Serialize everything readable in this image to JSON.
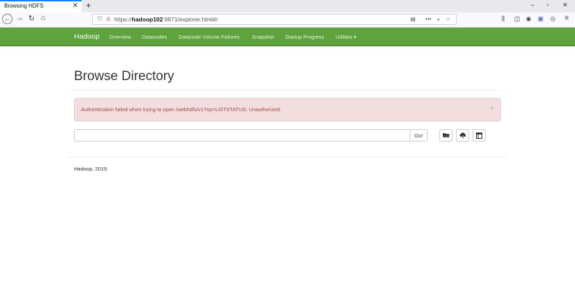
{
  "browser": {
    "tab_title": "Browsing HDFS",
    "tab_close": "✕",
    "new_tab": "+",
    "url_prefix": "https://",
    "url_host": "hadoop102",
    "url_rest": ":9871/explorer.html#/",
    "window_controls": [
      "–",
      "▫",
      "✕"
    ]
  },
  "navbar": {
    "brand": "Hadoop",
    "links": [
      "Overview",
      "Datanodes",
      "Datanode Volume Failures",
      "Snapshot",
      "Startup Progress",
      "Utilities ▾"
    ]
  },
  "page": {
    "title": "Browse Directory",
    "alert_message": "Authentication failed when trying to open /webhdfs/v1?op=LISTSTATUS: Unauthorized.",
    "alert_close": "×",
    "directory_value": "",
    "go_label": "Go!",
    "footer": "Hadoop, 2019."
  },
  "icons": {
    "folder": "folder-open-icon",
    "upload": "upload-icon",
    "table": "table-icon"
  }
}
